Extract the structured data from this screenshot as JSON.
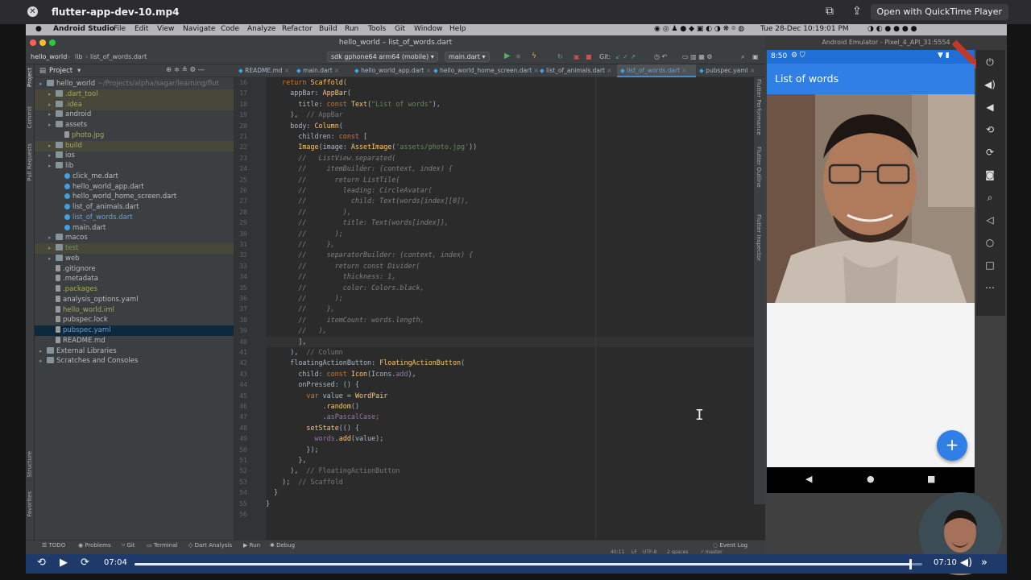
{
  "quicktime": {
    "file_title": "flutter-app-dev-10.mp4",
    "open_button": "Open with QuickTime Player",
    "current_time": "07:04",
    "remaining_time": "07:10",
    "progress_fraction": 0.985
  },
  "menubar": {
    "app": "Android Studio",
    "items": [
      "File",
      "Edit",
      "View",
      "Navigate",
      "Code",
      "Analyze",
      "Refactor",
      "Build",
      "Run",
      "Tools",
      "Git",
      "Window",
      "Help"
    ],
    "clock": "Tue 28-Dec 10:19:01 PM"
  },
  "studio": {
    "window_title": "hello_world – list_of_words.dart",
    "breadcrumb": [
      "hello_world",
      "lib",
      "list_of_words.dart"
    ],
    "device_dropdown": "sdk gphone64 arm64 (mobile)",
    "run_config": "main.dart",
    "git_label": "Git:",
    "project_label": "Project",
    "tree": [
      {
        "label": "hello_world",
        "suffix": "~/Projects/alpha/sagar/learning/flut",
        "depth": 0,
        "icon": "folder",
        "color": "#bbbbbb"
      },
      {
        "label": ".dart_tool",
        "depth": 1,
        "icon": "folder",
        "color": "#a8a85a",
        "excl": true
      },
      {
        "label": ".idea",
        "depth": 1,
        "icon": "folder",
        "color": "#a8a85a",
        "excl": true
      },
      {
        "label": "android",
        "depth": 1,
        "icon": "folder",
        "color": "#bbbbbb"
      },
      {
        "label": "assets",
        "depth": 1,
        "icon": "folder",
        "color": "#bbbbbb"
      },
      {
        "label": "photo.jpg",
        "depth": 2,
        "icon": "image",
        "color": "#a8a85a"
      },
      {
        "label": "build",
        "depth": 1,
        "icon": "folder",
        "color": "#a8a85a",
        "excl": true
      },
      {
        "label": "ios",
        "depth": 1,
        "icon": "folder",
        "color": "#bbbbbb"
      },
      {
        "label": "lib",
        "depth": 1,
        "icon": "folder",
        "color": "#bbbbbb"
      },
      {
        "label": "click_me.dart",
        "depth": 2,
        "icon": "dart",
        "color": "#bbbbbb"
      },
      {
        "label": "hello_world_app.dart",
        "depth": 2,
        "icon": "dart",
        "color": "#bbbbbb"
      },
      {
        "label": "hello_world_home_screen.dart",
        "depth": 2,
        "icon": "dart",
        "color": "#bbbbbb"
      },
      {
        "label": "list_of_animals.dart",
        "depth": 2,
        "icon": "dart",
        "color": "#bbbbbb"
      },
      {
        "label": "list_of_words.dart",
        "depth": 2,
        "icon": "dart",
        "color": "#6d9fd7"
      },
      {
        "label": "main.dart",
        "depth": 2,
        "icon": "dart",
        "color": "#bbbbbb"
      },
      {
        "label": "macos",
        "depth": 1,
        "icon": "folder",
        "color": "#bbbbbb"
      },
      {
        "label": "test",
        "depth": 1,
        "icon": "folder",
        "color": "#6a9f5a",
        "excl": true
      },
      {
        "label": "web",
        "depth": 1,
        "icon": "folder",
        "color": "#bbbbbb"
      },
      {
        "label": ".gitignore",
        "depth": 1,
        "icon": "text",
        "color": "#bbbbbb"
      },
      {
        "label": ".metadata",
        "depth": 1,
        "icon": "text",
        "color": "#bbbbbb"
      },
      {
        "label": ".packages",
        "depth": 1,
        "icon": "text",
        "color": "#a8a85a"
      },
      {
        "label": "analysis_options.yaml",
        "depth": 1,
        "icon": "text",
        "color": "#bbbbbb"
      },
      {
        "label": "hello_world.iml",
        "depth": 1,
        "icon": "text",
        "color": "#a8a85a"
      },
      {
        "label": "pubspec.lock",
        "depth": 1,
        "icon": "text",
        "color": "#bbbbbb"
      },
      {
        "label": "pubspec.yaml",
        "depth": 1,
        "icon": "text",
        "color": "#6d9fd7",
        "selected": true
      },
      {
        "label": "README.md",
        "depth": 1,
        "icon": "text",
        "color": "#bbbbbb"
      },
      {
        "label": "External Libraries",
        "depth": 0,
        "icon": "folder",
        "color": "#bbbbbb"
      },
      {
        "label": "Scratches and Consoles",
        "depth": 0,
        "icon": "folder",
        "color": "#bbbbbb"
      }
    ],
    "tabs": [
      {
        "label": "README.md",
        "active": false
      },
      {
        "label": "main.dart",
        "active": false
      },
      {
        "label": "hello_world_app.dart",
        "active": false
      },
      {
        "label": "hello_world_home_screen.dart",
        "active": false
      },
      {
        "label": "list_of_animals.dart",
        "active": false
      },
      {
        "label": "list_of_words.dart",
        "active": true
      },
      {
        "label": "pubspec.yaml",
        "active": false
      }
    ],
    "line_numbers": [
      16,
      17,
      18,
      19,
      20,
      21,
      22,
      23,
      24,
      25,
      26,
      27,
      28,
      29,
      30,
      31,
      32,
      33,
      34,
      35,
      36,
      37,
      38,
      39,
      40,
      41,
      42,
      43,
      44,
      45,
      46,
      47,
      48,
      49,
      50,
      51,
      52,
      53,
      54,
      55,
      56
    ],
    "code_lines": [
      [
        [
          "kw",
          "    return "
        ],
        [
          "fn",
          "Scaffold"
        ],
        [
          "t",
          "("
        ]
      ],
      [
        [
          "t",
          "      appBar: "
        ],
        [
          "fn",
          "AppBar"
        ],
        [
          "t",
          "("
        ]
      ],
      [
        [
          "t",
          "        title: "
        ],
        [
          "kw",
          "const "
        ],
        [
          "fn",
          "Text"
        ],
        [
          "t",
          "("
        ],
        [
          "str",
          "\"List of words\""
        ],
        [
          "t",
          "),"
        ]
      ],
      [
        [
          "t",
          "      ), "
        ],
        [
          "hint",
          " // AppBar"
        ]
      ],
      [
        [
          "t",
          "      body: "
        ],
        [
          "fn",
          "Column"
        ],
        [
          "t",
          "("
        ]
      ],
      [
        [
          "t",
          "        children: "
        ],
        [
          "kw",
          "const "
        ],
        [
          "t",
          "["
        ]
      ],
      [
        [
          "t",
          "        "
        ],
        [
          "fn",
          "Image"
        ],
        [
          "t",
          "(image: "
        ],
        [
          "fn",
          "AssetImage"
        ],
        [
          "t",
          "("
        ],
        [
          "str",
          "'assets/photo.jpg'"
        ],
        [
          "t",
          "))"
        ]
      ],
      [
        [
          "cm",
          "        //   ListView.separated("
        ]
      ],
      [
        [
          "cm",
          "        //     itemBuilder: (context, index) {"
        ]
      ],
      [
        [
          "cm",
          "        //       return ListTile("
        ]
      ],
      [
        [
          "cm",
          "        //         leading: CircleAvatar("
        ]
      ],
      [
        [
          "cm",
          "        //           child: Text(words[index][0]),"
        ]
      ],
      [
        [
          "cm",
          "        //         ),"
        ]
      ],
      [
        [
          "cm",
          "        //         title: Text(words[index]),"
        ]
      ],
      [
        [
          "cm",
          "        //       );"
        ]
      ],
      [
        [
          "cm",
          "        //     },"
        ]
      ],
      [
        [
          "cm",
          "        //     separatorBuilder: (context, index) {"
        ]
      ],
      [
        [
          "cm",
          "        //       return const Divider("
        ]
      ],
      [
        [
          "cm",
          "        //         thickness: 1,"
        ]
      ],
      [
        [
          "cm",
          "        //         color: Colors.black,"
        ]
      ],
      [
        [
          "cm",
          "        //       );"
        ]
      ],
      [
        [
          "cm",
          "        //     },"
        ]
      ],
      [
        [
          "cm",
          "        //     itemCount: words.length,"
        ]
      ],
      [
        [
          "cm",
          "        //   ),"
        ]
      ],
      [
        [
          "t",
          "        ],"
        ]
      ],
      [
        [
          "t",
          "      ), "
        ],
        [
          "hint",
          " // Column"
        ]
      ],
      [
        [
          "t",
          "      floatingActionButton: "
        ],
        [
          "fn",
          "FloatingActionButton"
        ],
        [
          "t",
          "("
        ]
      ],
      [
        [
          "t",
          "        child: "
        ],
        [
          "kw",
          "const "
        ],
        [
          "fn",
          "Icon"
        ],
        [
          "t",
          "(Icons."
        ],
        [
          "prop",
          "add"
        ],
        [
          "t",
          "),"
        ]
      ],
      [
        [
          "t",
          "        onPressed: () {"
        ]
      ],
      [
        [
          "t",
          "          "
        ],
        [
          "kw",
          "var "
        ],
        [
          "t",
          "value = "
        ],
        [
          "fn",
          "WordPair"
        ]
      ],
      [
        [
          "t",
          "              ."
        ],
        [
          "fn",
          "random"
        ],
        [
          "t",
          "()"
        ]
      ],
      [
        [
          "t",
          "              ."
        ],
        [
          "prop",
          "asPascalCase"
        ],
        [
          "kw",
          ";"
        ]
      ],
      [
        [
          "t",
          "          "
        ],
        [
          "fn",
          "setState"
        ],
        [
          "t",
          "(() {"
        ]
      ],
      [
        [
          "t",
          "            "
        ],
        [
          "prop",
          "words"
        ],
        [
          "t",
          "."
        ],
        [
          "fn",
          "add"
        ],
        [
          "t",
          "(value);"
        ]
      ],
      [
        [
          "t",
          "          });"
        ]
      ],
      [
        [
          "t",
          "        },"
        ]
      ],
      [
        [
          "t",
          "      ), "
        ],
        [
          "hint",
          " // FloatingActionButton"
        ]
      ],
      [
        [
          "t",
          "    ); "
        ],
        [
          "hint",
          " // Scaffold"
        ]
      ],
      [
        [
          "t",
          "  }"
        ]
      ],
      [
        [
          "t",
          "}"
        ]
      ],
      [
        [
          "t",
          ""
        ]
      ]
    ],
    "current_line_index": 24,
    "bottom_tools": [
      "TODO",
      "Problems",
      "Git",
      "Terminal",
      "Dart Analysis",
      "Run",
      "Debug"
    ],
    "event_log": "Event Log",
    "status": {
      "position": "40:11",
      "line_sep": "LF",
      "encoding": "UTF-8",
      "indent": "2 spaces",
      "branch": "master"
    },
    "side_tools_left": [
      "Project",
      "Commit",
      "Pull Requests",
      "Structure",
      "Favorites"
    ],
    "side_tools_right": [
      "Flutter Performance",
      "Flutter Outline",
      "Flutter Inspector"
    ]
  },
  "emulator": {
    "title": "Android Emulator - Pixel_4_API_31:5554",
    "status_time": "8:50",
    "app_title": "List of words",
    "fab_label": "+"
  }
}
